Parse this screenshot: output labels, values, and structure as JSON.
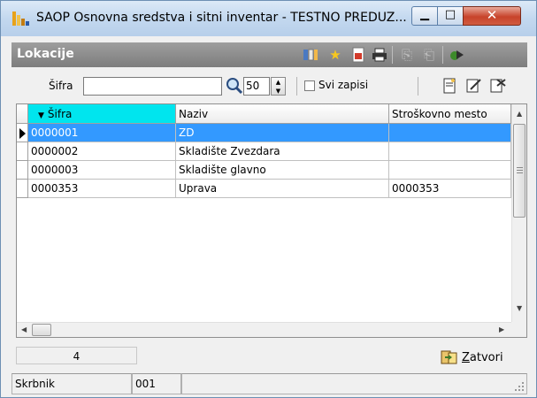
{
  "window": {
    "title": "SAOP  Osnovna sredstva i sitni inventar - TESTNO PREDUZ..."
  },
  "panel": {
    "title": "Lokacije"
  },
  "filter": {
    "sifra_label": "Šifra",
    "sifra_value": "",
    "limit_value": "50",
    "all_records_label": "Svi zapisi",
    "all_records_checked": false
  },
  "grid": {
    "columns": [
      "Šifra",
      "Naziv",
      "Stroškovno mesto"
    ],
    "sort_column": "Šifra",
    "rows": [
      {
        "sifra": "0000001",
        "naziv": "ZD",
        "mesto": ""
      },
      {
        "sifra": "0000002",
        "naziv": "Skladište Zvezdara",
        "mesto": ""
      },
      {
        "sifra": "0000003",
        "naziv": "Skladište glavno",
        "mesto": ""
      },
      {
        "sifra": "0000353",
        "naziv": "Uprava",
        "mesto": "0000353"
      }
    ],
    "selected_row": 0
  },
  "footer": {
    "record_count": "4",
    "close_label": "Zatvori"
  },
  "status": {
    "user_label": "Skrbnik",
    "user_code": "001",
    "extra": ""
  },
  "colors": {
    "selection": "#3399ff",
    "sorted_header": "#00e5ee",
    "panel_bar": "#8a8a8a"
  }
}
